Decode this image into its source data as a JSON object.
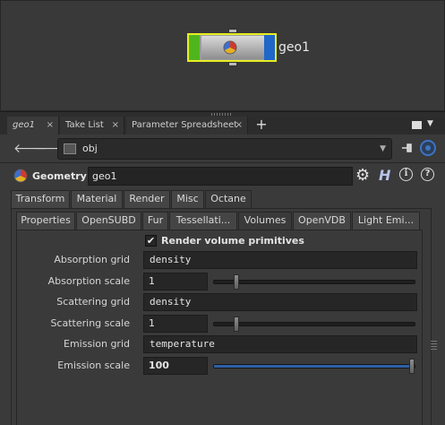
{
  "network": {
    "node_label": "geo1",
    "colors": {
      "selected": "#e7ee22",
      "display_flag": "#4fb51e",
      "render_flag": "#1f67c8"
    }
  },
  "pane_tabs": [
    {
      "label": "geo1",
      "active": true
    },
    {
      "label": "Take List",
      "active": false
    },
    {
      "label": "Parameter Spreadsheet",
      "active": false
    }
  ],
  "pane_tab_close": "×",
  "pane_tab_add": "+",
  "path": {
    "value": "obj",
    "icon": "obj-network-icon"
  },
  "param_header": {
    "type": "Geometry",
    "name": "geo1"
  },
  "main_tabs": [
    {
      "label": "Transform",
      "active": false
    },
    {
      "label": "Material",
      "active": false
    },
    {
      "label": "Render",
      "active": true
    },
    {
      "label": "Misc",
      "active": false
    },
    {
      "label": "Octane",
      "active": false
    }
  ],
  "sub_tabs": [
    {
      "label": "Properties",
      "active": false
    },
    {
      "label": "OpenSUBD",
      "active": false
    },
    {
      "label": "Fur",
      "active": false
    },
    {
      "label": "Tessellati...",
      "active": false
    },
    {
      "label": "Volumes",
      "active": true
    },
    {
      "label": "OpenVDB",
      "active": false
    },
    {
      "label": "Light Emi...",
      "active": false
    }
  ],
  "params": {
    "render_volume": {
      "label": "Render volume primitives",
      "checked": true,
      "mark": "✔"
    },
    "absorption_grid": {
      "label": "Absorption grid",
      "value": "density"
    },
    "absorption_scale": {
      "label": "Absorption scale",
      "value": "1",
      "slider_fraction": 0.1
    },
    "scattering_grid": {
      "label": "Scattering grid",
      "value": "density"
    },
    "scattering_scale": {
      "label": "Scattering scale",
      "value": "1",
      "slider_fraction": 0.1
    },
    "emission_grid": {
      "label": "Emission grid",
      "value": "temperature"
    },
    "emission_scale": {
      "label": "Emission scale",
      "value": "100",
      "slider_fraction": 1.0
    }
  }
}
